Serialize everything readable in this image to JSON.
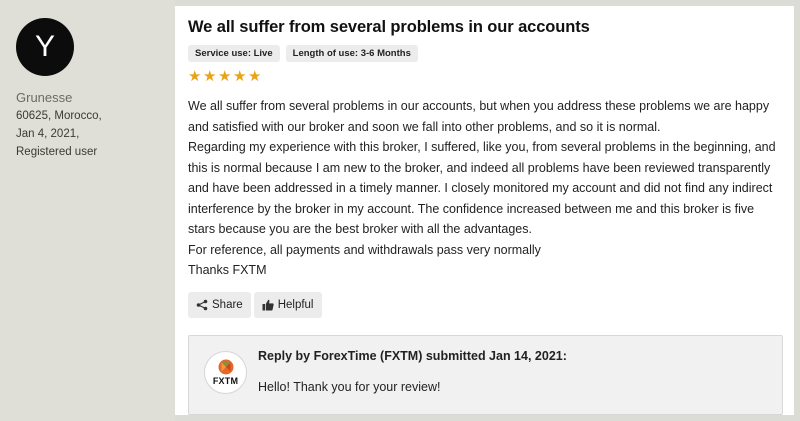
{
  "user": {
    "avatar_letter": "Y",
    "name": "Grunesse",
    "location": "60625, Morocco,",
    "date": "Jan 4, 2021,",
    "status": "Registered user"
  },
  "review": {
    "title": "We all suffer from several problems in our accounts",
    "tags": [
      "Service use: Live",
      "Length of use: 3-6 Months"
    ],
    "rating": 5,
    "rating_max": 5,
    "star_color": "#e8a317",
    "paragraphs": [
      "We all suffer from several problems in our accounts, but when you address these problems we are happy and satisfied with our broker and soon we fall into other problems, and so it is normal.",
      "Regarding my experience with this broker, I suffered, like you, from several problems in the beginning, and this is normal because I am new to the broker, and indeed all problems have been reviewed transparently and have been addressed in a timely manner. I closely monitored my account and did not find any indirect interference by the broker in my account. The confidence increased between me and this broker is five stars because you are the best broker with all the advantages.",
      "For reference, all payments and withdrawals pass very normally",
      "Thanks FXTM"
    ]
  },
  "actions": {
    "share_label": "Share",
    "share_icon": "share-icon",
    "helpful_label": "Helpful",
    "helpful_icon": "thumbs-up-icon"
  },
  "reply": {
    "logo_text": "FXTM",
    "header": "Reply by ForexTime (FXTM) submitted Jan 14, 2021:",
    "text": "Hello! Thank you for your review!"
  }
}
